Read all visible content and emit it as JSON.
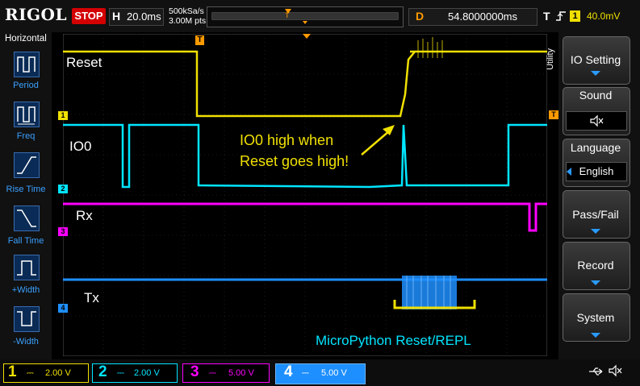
{
  "topbar": {
    "logo": "RIGOL",
    "run_state": "STOP",
    "timebase_letter": "H",
    "timebase_value": "20.0ms",
    "sample_rate": "500kSa/s",
    "memory_depth": "3.00M pts",
    "delay_letter": "D",
    "delay_value": "54.8000000ms",
    "trigger_letter": "T",
    "trigger_channel": "1",
    "trigger_level": "40.0mV"
  },
  "left_menu": {
    "title": "Horizontal",
    "items": [
      {
        "label": "Period"
      },
      {
        "label": "Freq"
      },
      {
        "label": "Rise Time"
      },
      {
        "label": "Fall Time"
      },
      {
        "label": "+Width"
      },
      {
        "label": "-Width"
      }
    ]
  },
  "right_menu": {
    "tab_label": "Utility",
    "items": [
      {
        "label": "IO Setting",
        "sub": ""
      },
      {
        "label": "Sound",
        "sub": ""
      },
      {
        "label": "Language",
        "sub": "English"
      },
      {
        "label": "Pass/Fail",
        "sub": ""
      },
      {
        "label": "Record",
        "sub": ""
      },
      {
        "label": "System",
        "sub": ""
      }
    ]
  },
  "channels": [
    {
      "num": "1",
      "scale": "2.00 V",
      "color": "#f0e000"
    },
    {
      "num": "2",
      "scale": "2.00 V",
      "color": "#00e5ff"
    },
    {
      "num": "3",
      "scale": "5.00 V",
      "color": "#ff00ff"
    },
    {
      "num": "4",
      "scale": "5.00 V",
      "color": "#1e8fff"
    }
  ],
  "annotations": {
    "reset": "Reset",
    "io0": "IO0",
    "rx": "Rx",
    "tx": "Tx",
    "note_line1": "IO0 high when",
    "note_line2": "Reset goes high!",
    "bracket_label": "MicroPython Reset/REPL"
  },
  "trace_markers": {
    "t": "T",
    "ch1": "1",
    "ch2": "2",
    "ch3": "3",
    "ch4": "4"
  },
  "colors": {
    "ch1": "#f0e000",
    "ch2": "#00e5ff",
    "ch3": "#ff00ff",
    "ch4": "#1e8fff",
    "accent": "#2a9bff",
    "stop": "#d40000",
    "trigger": "#ff9a00"
  }
}
